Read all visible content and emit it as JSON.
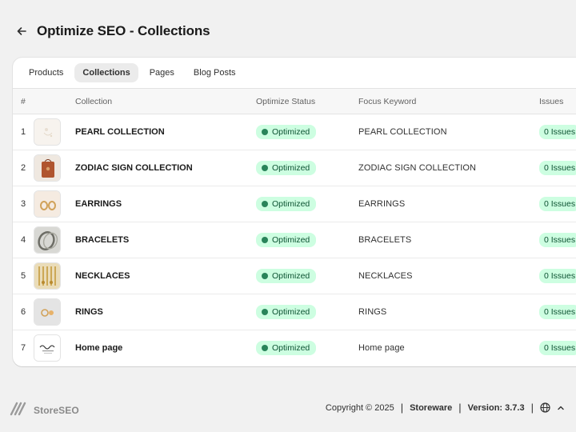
{
  "header": {
    "back_icon": "arrow-left-icon",
    "title": "Optimize SEO - Collections"
  },
  "tabs": [
    {
      "label": "Products",
      "active": false
    },
    {
      "label": "Collections",
      "active": true
    },
    {
      "label": "Pages",
      "active": false
    },
    {
      "label": "Blog Posts",
      "active": false
    }
  ],
  "table": {
    "columns": [
      "#",
      "Collection",
      "Optimize Status",
      "Focus Keyword",
      "Issues"
    ],
    "rows": [
      {
        "num": "1",
        "name": "PEARL COLLECTION",
        "status": "Optimized",
        "keyword": "PEARL COLLECTION",
        "issues": "0 Issues"
      },
      {
        "num": "2",
        "name": "ZODIAC SIGN COLLECTION",
        "status": "Optimized",
        "keyword": "ZODIAC SIGN COLLECTION",
        "issues": "0 Issues"
      },
      {
        "num": "3",
        "name": "EARRINGS",
        "status": "Optimized",
        "keyword": "EARRINGS",
        "issues": "0 Issues"
      },
      {
        "num": "4",
        "name": "BRACELETS",
        "status": "Optimized",
        "keyword": "BRACELETS",
        "issues": "0 Issues"
      },
      {
        "num": "5",
        "name": "NECKLACES",
        "status": "Optimized",
        "keyword": "NECKLACES",
        "issues": "0 Issues"
      },
      {
        "num": "6",
        "name": "RINGS",
        "status": "Optimized",
        "keyword": "RINGS",
        "issues": "0 Issues"
      },
      {
        "num": "7",
        "name": "Home page",
        "status": "Optimized",
        "keyword": "Home page",
        "issues": "0 Issues"
      }
    ]
  },
  "footer": {
    "brand": "StoreSEO",
    "copyright": "Copyright © 2025",
    "company": "Storeware",
    "version": "Version: 3.7.3",
    "globe_icon": "globe-icon",
    "chevron_icon": "chevron-up-icon"
  },
  "colors": {
    "badge_bg": "#cdfee1",
    "badge_text": "#0c5132",
    "badge_dot": "#29845a",
    "page_bg": "#f1f1f1"
  }
}
